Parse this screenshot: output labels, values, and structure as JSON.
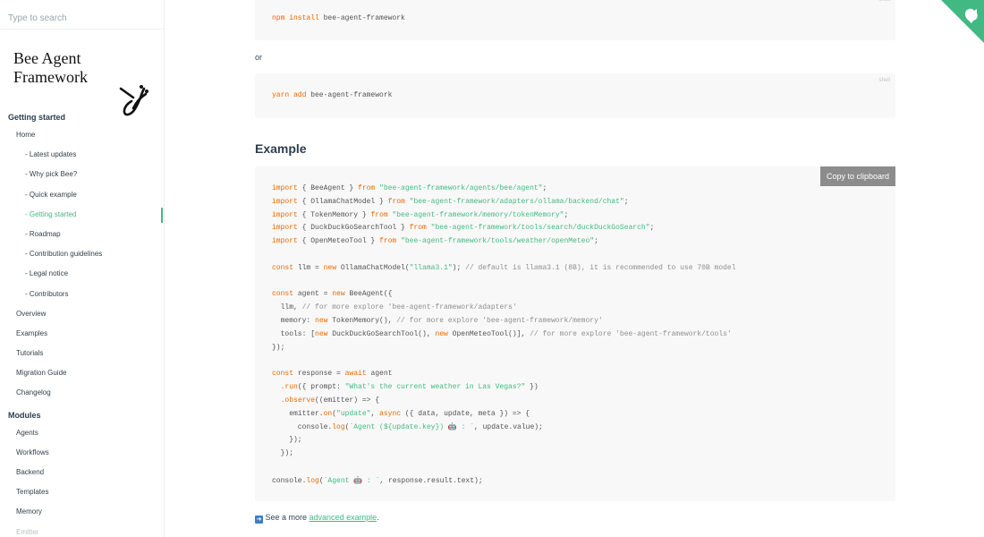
{
  "search": {
    "placeholder": "Type to search"
  },
  "brand": {
    "title": "Bee Agent Framework"
  },
  "nav": {
    "section1": "Getting started",
    "items1": [
      "Home"
    ],
    "subitems": [
      "- Latest updates",
      "- Why pick Bee?",
      "- Quick example",
      "- Getting started",
      "- Roadmap",
      "- Contribution guidelines",
      "- Legal notice",
      "- Contributors"
    ],
    "items2": [
      "Overview",
      "Examples",
      "Tutorials",
      "Migration Guide",
      "Changelog"
    ],
    "section2": "Modules",
    "items3": [
      "Agents",
      "Workflows",
      "Backend",
      "Templates",
      "Memory",
      "Emitter"
    ]
  },
  "install": {
    "npm": {
      "tag": "shell",
      "cmd": "npm install",
      "pkg": " bee-agent-framework"
    },
    "or": "or",
    "yarn": {
      "tag": "shell",
      "cmd": "yarn add",
      "pkg": " bee-agent-framework"
    }
  },
  "example": {
    "heading": "Example",
    "copy_label": "Copy to clipboard",
    "lines": [
      [
        [
          "kw",
          "import"
        ],
        [
          "p",
          " { BeeAgent } "
        ],
        [
          "kw",
          "from"
        ],
        [
          "p",
          " "
        ],
        [
          "str",
          "\"bee-agent-framework/agents/bee/agent\""
        ],
        [
          "p",
          ";"
        ]
      ],
      [
        [
          "kw",
          "import"
        ],
        [
          "p",
          " { OllamaChatModel } "
        ],
        [
          "kw",
          "from"
        ],
        [
          "p",
          " "
        ],
        [
          "str",
          "\"bee-agent-framework/adapters/ollama/backend/chat\""
        ],
        [
          "p",
          ";"
        ]
      ],
      [
        [
          "kw",
          "import"
        ],
        [
          "p",
          " { TokenMemory } "
        ],
        [
          "kw",
          "from"
        ],
        [
          "p",
          " "
        ],
        [
          "str",
          "\"bee-agent-framework/memory/tokenMemory\""
        ],
        [
          "p",
          ";"
        ]
      ],
      [
        [
          "kw",
          "import"
        ],
        [
          "p",
          " { DuckDuckGoSearchTool } "
        ],
        [
          "kw",
          "from"
        ],
        [
          "p",
          " "
        ],
        [
          "str",
          "\"bee-agent-framework/tools/search/duckDuckGoSearch\""
        ],
        [
          "p",
          ";"
        ]
      ],
      [
        [
          "kw",
          "import"
        ],
        [
          "p",
          " { OpenMeteoTool } "
        ],
        [
          "kw",
          "from"
        ],
        [
          "p",
          " "
        ],
        [
          "str",
          "\"bee-agent-framework/tools/weather/openMeteo\""
        ],
        [
          "p",
          ";"
        ]
      ],
      [],
      [
        [
          "kw",
          "const"
        ],
        [
          "p",
          " llm = "
        ],
        [
          "kw",
          "new"
        ],
        [
          "p",
          " OllamaChatModel("
        ],
        [
          "str",
          "\"llama3.1\""
        ],
        [
          "p",
          "); "
        ],
        [
          "cm",
          "// default is llama3.1 (8B), it is recommended to use 70B model"
        ]
      ],
      [],
      [
        [
          "kw",
          "const"
        ],
        [
          "p",
          " agent = "
        ],
        [
          "kw",
          "new"
        ],
        [
          "p",
          " BeeAgent({"
        ]
      ],
      [
        [
          "p",
          "  llm, "
        ],
        [
          "cm",
          "// for more explore 'bee-agent-framework/adapters'"
        ]
      ],
      [
        [
          "p",
          "  memory: "
        ],
        [
          "kw",
          "new"
        ],
        [
          "p",
          " TokenMemory(), "
        ],
        [
          "cm",
          "// for more explore 'bee-agent-framework/memory'"
        ]
      ],
      [
        [
          "p",
          "  tools: ["
        ],
        [
          "kw",
          "new"
        ],
        [
          "p",
          " DuckDuckGoSearchTool(), "
        ],
        [
          "kw",
          "new"
        ],
        [
          "p",
          " OpenMeteoTool()], "
        ],
        [
          "cm",
          "// for more explore 'bee-agent-framework/tools'"
        ]
      ],
      [
        [
          "p",
          "});"
        ]
      ],
      [],
      [
        [
          "kw",
          "const"
        ],
        [
          "p",
          " response = "
        ],
        [
          "kw",
          "await"
        ],
        [
          "p",
          " agent"
        ]
      ],
      [
        [
          "p",
          "  "
        ],
        [
          "kw",
          ".run"
        ],
        [
          "p",
          "({ prompt: "
        ],
        [
          "str",
          "\"What's the current weather in Las Vegas?\""
        ],
        [
          "p",
          " })"
        ]
      ],
      [
        [
          "p",
          "  "
        ],
        [
          "kw",
          ".observe"
        ],
        [
          "p",
          "((emitter) => {"
        ]
      ],
      [
        [
          "p",
          "    emitter."
        ],
        [
          "kw",
          "on"
        ],
        [
          "p",
          "("
        ],
        [
          "str",
          "\"update\""
        ],
        [
          "p",
          ", "
        ],
        [
          "kw",
          "async"
        ],
        [
          "p",
          " ({ data, update, meta }) => {"
        ]
      ],
      [
        [
          "p",
          "      console."
        ],
        [
          "kw",
          "log"
        ],
        [
          "p",
          "("
        ],
        [
          "str",
          "`Agent (${update.key}) 🤖 : `"
        ],
        [
          "p",
          ", update.value);"
        ]
      ],
      [
        [
          "p",
          "    });"
        ]
      ],
      [
        [
          "p",
          "  });"
        ]
      ],
      [],
      [
        [
          "p",
          "console."
        ],
        [
          "kw",
          "log"
        ],
        [
          "p",
          "("
        ],
        [
          "str",
          "`Agent 🤖 : `"
        ],
        [
          "p",
          ", response.result.text);"
        ]
      ]
    ]
  },
  "footer": {
    "prefix": " See a more ",
    "link": "advanced example",
    "suffix": "."
  },
  "colors": {
    "accent": "#42b983",
    "keyword": "#e96900",
    "comment": "#8e908c"
  }
}
